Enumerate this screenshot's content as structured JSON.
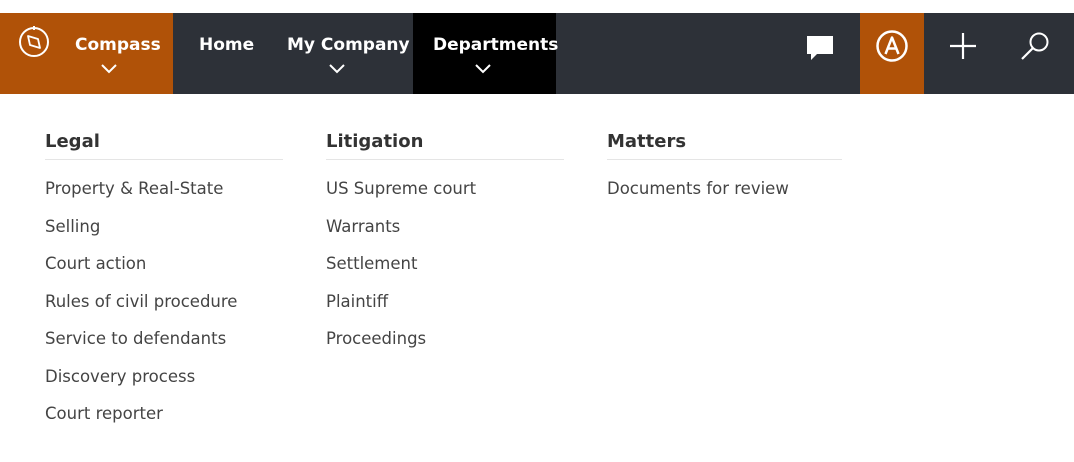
{
  "nav": {
    "brand_label": "Compass",
    "home_label": "Home",
    "mycompany_label": "My Company",
    "departments_label": "Departments",
    "icons": [
      "compass-icon",
      "chat-icon",
      "profile-icon",
      "add-icon",
      "search-icon"
    ],
    "accent_color": "#b05208",
    "bar_color": "#2d3138",
    "active_color": "#000000"
  },
  "menu": {
    "columns": [
      {
        "heading": "Legal",
        "items": [
          "Property & Real-State",
          "Selling",
          "Court action",
          "Rules of civil procedure",
          "Service to defendants",
          "Discovery process",
          "Court reporter"
        ]
      },
      {
        "heading": "Litigation",
        "items": [
          "US Supreme court",
          "Warrants",
          "Settlement",
          "Plaintiff",
          "Proceedings"
        ]
      },
      {
        "heading": "Matters",
        "items": [
          "Documents for review"
        ]
      }
    ]
  }
}
